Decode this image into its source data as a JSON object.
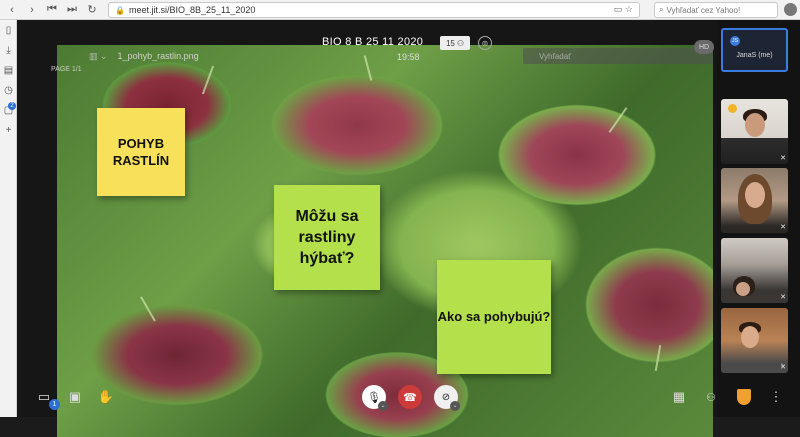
{
  "browser": {
    "url": "meet.jit.si/BIO_8B_25_11_2020",
    "search_placeholder": "Vyhľadať cez Yahoo!"
  },
  "sidebar": {
    "badge_count": "2"
  },
  "meeting": {
    "title": "BIO 8 B 25 11 2020",
    "time": "19:58",
    "participant_count": "15",
    "find_placeholder": "Vyhľadať",
    "hd_label": "HD"
  },
  "viewer": {
    "file_name": "1_pohyb_rastlin.png",
    "page_label": "PAGE 1/1"
  },
  "slide": {
    "note_1": "POHYB RASTLÍN",
    "note_2": "Môžu sa rastliny hýbať?",
    "note_3": "Ako sa pohybujú?"
  },
  "filmstrip": {
    "me_name": "JanaS (me)",
    "me_initials": "JS"
  },
  "toolbar": {
    "chat_badge": "1"
  },
  "colors": {
    "accent": "#2d6fd6",
    "hangup": "#cc3a3a",
    "note_yellow": "#f7e15a",
    "note_green": "#b4e04b",
    "security": "#f0a030"
  }
}
